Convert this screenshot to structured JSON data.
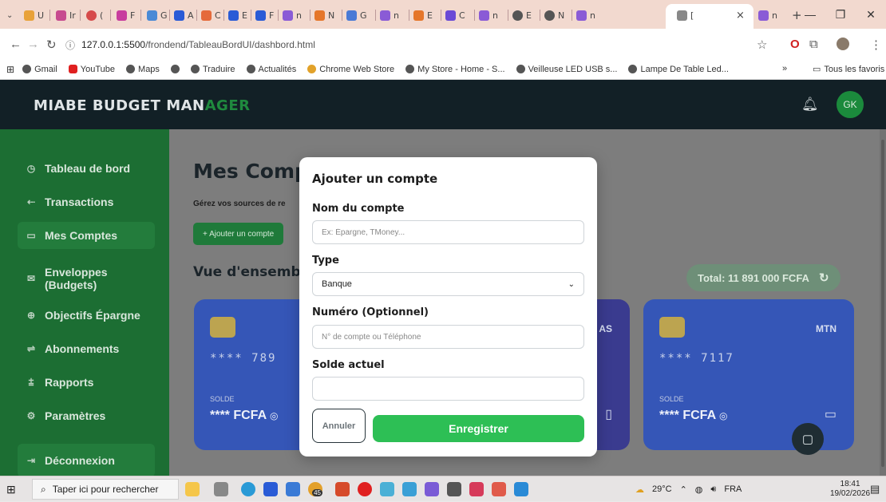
{
  "browser": {
    "tab_labels": [
      "U",
      "Ir",
      "(",
      "F",
      "G",
      "A",
      "C",
      "E",
      "F",
      "n",
      "N",
      "G",
      "n",
      "E",
      "C",
      "n",
      "E",
      "N",
      "n",
      "[",
      "n"
    ],
    "active_tab_close": "×",
    "new_tab": "+",
    "url_host": "127.0.0.1:5500",
    "url_path": "/frondend/TableauBordUI/dashbord.html",
    "bookmarks": [
      "Gmail",
      "YouTube",
      "Maps",
      "Traduire",
      "Actualités",
      "Chrome Web Store",
      "My Store - Home - S...",
      "Veilleuse LED USB s...",
      "Lampe De Table Led..."
    ],
    "bookmarks_overflow": "»",
    "all_bookmarks": "Tous les favoris"
  },
  "app": {
    "brand_part1": "MIABE BUDGET MAN",
    "brand_part2": "AGER",
    "avatar": "GK"
  },
  "sidebar": {
    "items": [
      {
        "label": "Tableau de bord",
        "icon": "dashboard-icon"
      },
      {
        "label": "Transactions",
        "icon": "arrows-icon"
      },
      {
        "label": "Mes Comptes",
        "icon": "wallet-icon"
      },
      {
        "label": "Enveloppes (Budgets)",
        "icon": "envelope-icon"
      },
      {
        "label": "Objectifs Épargne",
        "icon": "target-icon"
      },
      {
        "label": "Abonnements",
        "icon": "repeat-icon"
      },
      {
        "label": "Rapports",
        "icon": "report-icon"
      },
      {
        "label": "Paramètres",
        "icon": "gear-icon"
      }
    ],
    "logout": "Déconnexion"
  },
  "main": {
    "title": "Mes Compt",
    "subtitle": "Gérez vos sources de re",
    "add_button": "+ Ajouter un compte",
    "overview": "Vue d'ensemble",
    "total": "Total: 11 891 000 FCFA"
  },
  "cards": [
    {
      "number": "**** 789",
      "balance_label": "SOLDE",
      "balance": "**** FCFA",
      "operator": ""
    },
    {
      "number": "",
      "balance_label": "",
      "balance": "",
      "operator": "AS"
    },
    {
      "number": "**** 7117",
      "balance_label": "SOLDE",
      "balance": "**** FCFA",
      "operator": "MTN"
    }
  ],
  "modal": {
    "title": "Ajouter un compte",
    "name_label": "Nom du compte",
    "name_placeholder": "Ex: Épargne, TMoney...",
    "type_label": "Type",
    "type_value": "Banque",
    "number_label": "Numéro (Optionnel)",
    "number_placeholder": "N° de compte ou Téléphone",
    "balance_label": "Solde actuel",
    "balance_value": "",
    "cancel": "Annuler",
    "save": "Enregistrer"
  },
  "taskbar": {
    "search_placeholder": "Taper ici pour rechercher",
    "weather": "29°C",
    "lang": "FRA",
    "time": "18:41",
    "date": "19/02/2026",
    "badge": "45",
    "notif_count": "5"
  },
  "colors": {
    "sidebar": "#1c6e33",
    "topbar": "#122026",
    "save": "#2dbf55",
    "card_blue": "#3556b7"
  }
}
